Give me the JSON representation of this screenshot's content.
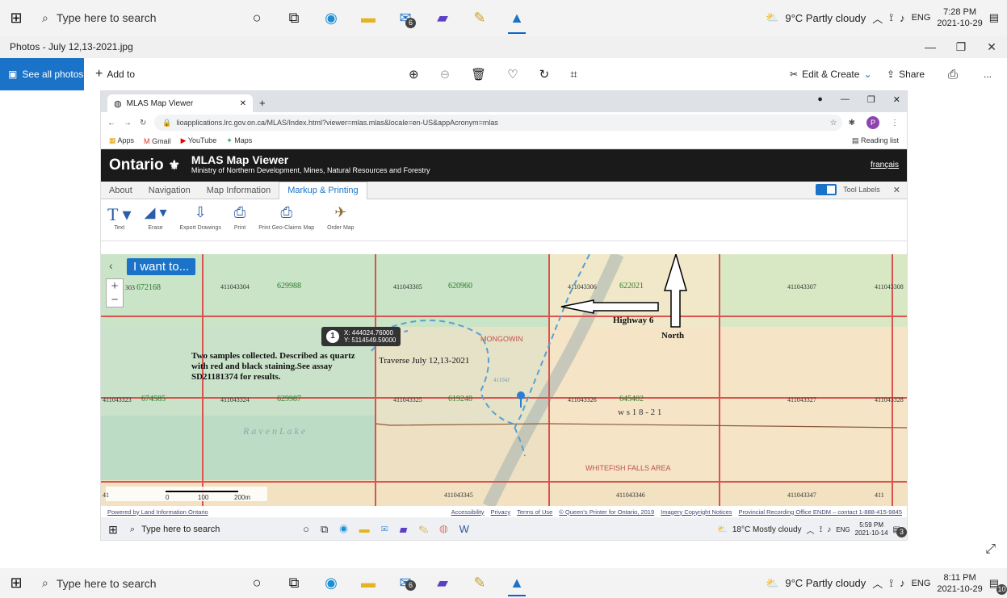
{
  "taskbar_top": {
    "search_placeholder": "Type here to search",
    "weather": "9°C Partly cloudy",
    "lang": "ENG",
    "time": "7:28 PM",
    "date": "2021-10-29",
    "mail_badge": "6",
    "notif_badge": "11"
  },
  "photos": {
    "title": "Photos - July 12,13-2021.jpg",
    "see_all": "See all photos",
    "add_to": "Add to",
    "edit_create": "Edit & Create",
    "share": "Share",
    "more": "..."
  },
  "browser": {
    "tab_title": "MLAS Map Viewer",
    "url": "lioapplications.lrc.gov.on.ca/MLAS/Index.html?viewer=mlas.mlas&locale=en-US&appAcronym=mlas",
    "bookmarks": [
      "Apps",
      "Gmail",
      "YouTube",
      "Maps"
    ],
    "reading_list": "Reading list",
    "profile_letter": "P"
  },
  "mlas": {
    "logo": "Ontario",
    "title": "MLAS Map Viewer",
    "subtitle": "Ministry of Northern Development, Mines, Natural Resources and Forestry",
    "french": "français",
    "nav": [
      "About",
      "Navigation",
      "Map Information",
      "Markup & Printing"
    ],
    "tool_labels": "Tool Labels",
    "tools": [
      "Text",
      "Erase",
      "Export Drawings",
      "Print",
      "Print Geo-Claims Map",
      "Order Map"
    ],
    "i_want": "I want to...",
    "coord_num": "1",
    "coord_x": "X: 444024.76000",
    "coord_y": "Y: 5114549.59000"
  },
  "map": {
    "cells_row1": [
      {
        "id": "303",
        "claim": "672168"
      },
      {
        "id": "411043304",
        "claim": "629988"
      },
      {
        "id": "411043305",
        "claim": "620960"
      },
      {
        "id": "411043306",
        "claim": "622021"
      },
      {
        "id": "411043307",
        "claim": ""
      },
      {
        "id": "411043308",
        "claim": ""
      }
    ],
    "cells_row2": [
      {
        "id": "411043323",
        "claim": "674585"
      },
      {
        "id": "411043324",
        "claim": "629987"
      },
      {
        "id": "411043325",
        "claim": "619248"
      },
      {
        "id": "411043326",
        "claim": "645402"
      },
      {
        "id": "411043327",
        "claim": ""
      },
      {
        "id": "411043328",
        "claim": ""
      }
    ],
    "cells_row3": [
      "41",
      "411043345",
      "411043346",
      "411043347",
      "411"
    ],
    "mongowin": "MONGOWIN",
    "whitefish": "WHITEFISH FALLS AREA",
    "raven_lake": "R a v e n   L a k e",
    "small_label": "41104J",
    "ws": "w s 1 8 - 2 1",
    "note": "Two samples collected. Described as quartz with red and black staining.See assay SD21181374 for results.",
    "traverse": "Traverse July 12,13-2021",
    "highway": "Highway 6",
    "north": "North",
    "scale_0": "0",
    "scale_100": "100",
    "scale_200": "200m"
  },
  "footer": {
    "left": "Powered by Land Information Ontario",
    "links": [
      "Accessibility",
      "Privacy",
      "Terms of Use",
      "© Queen's Printer for Ontario, 2019",
      "Imagery Copyright Notices",
      "Provincial Recording Office ENDM – contact 1-888-415-9845"
    ]
  },
  "taskbar_inner": {
    "search_placeholder": "Type here to search",
    "weather": "18°C Mostly cloudy",
    "lang": "ENG",
    "time": "5:59 PM",
    "date": "2021-10-14",
    "notif_badge": "3"
  },
  "taskbar_bottom": {
    "search_placeholder": "Type here to search",
    "weather": "9°C Partly cloudy",
    "lang": "ENG",
    "time": "8:11 PM",
    "date": "2021-10-29",
    "mail_badge": "6",
    "notif_badge": "10"
  }
}
